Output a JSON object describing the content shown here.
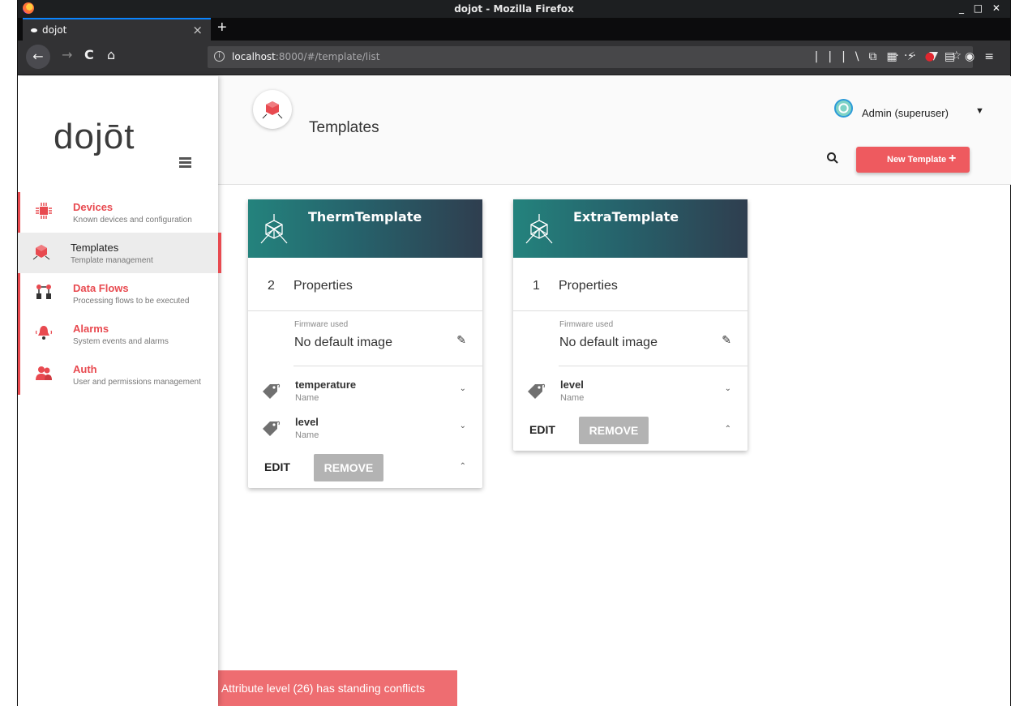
{
  "window": {
    "title": "dojot - Mozilla Firefox",
    "controls": "_ □ ✕"
  },
  "tab": {
    "label": "dojot",
    "close": "×",
    "new_tab": "+"
  },
  "navbar": {
    "back": "←",
    "forward": "→",
    "reload": "C",
    "home": "⌂",
    "url_host": "localhost",
    "url_path": ":8000/#/template/list",
    "info_icon": "i",
    "page_actions": "··· ▼ ☆"
  },
  "toolbar_icons": [
    "|||\\",
    "⧉",
    "▦",
    "⚡",
    "●",
    "▤",
    "◉",
    "≡"
  ],
  "sidebar": {
    "logo": "dojōt",
    "items": [
      {
        "label": "Devices",
        "sub": "Known devices and configuration",
        "icon": "chip-icon"
      },
      {
        "label": "Templates",
        "sub": "Template management",
        "icon": "cube-icon",
        "active": true
      },
      {
        "label": "Data Flows",
        "sub": "Processing flows to be executed",
        "icon": "flow-icon"
      },
      {
        "label": "Alarms",
        "sub": "System events and alarms",
        "icon": "bell-icon"
      },
      {
        "label": "Auth",
        "sub": "User and permissions management",
        "icon": "users-icon"
      }
    ]
  },
  "header": {
    "title": "Templates",
    "user": "Admin (superuser)",
    "caret": "▼",
    "search": "🔍",
    "new_button": "New Template",
    "new_plus": "+"
  },
  "cards": [
    {
      "name": "ThermTemplate",
      "count": "2",
      "props_label": "Properties",
      "fw_label": "Firmware used",
      "fw_value": "No default image",
      "attrs": [
        {
          "name": "temperature",
          "sub": "Name"
        },
        {
          "name": "level",
          "sub": "Name"
        }
      ],
      "edit": "EDIT",
      "remove": "REMOVE"
    },
    {
      "name": "ExtraTemplate",
      "count": "1",
      "props_label": "Properties",
      "fw_label": "Firmware used",
      "fw_value": "No default image",
      "attrs": [
        {
          "name": "level",
          "sub": "Name"
        }
      ],
      "edit": "EDIT",
      "remove": "REMOVE"
    }
  ],
  "chevron_down": "⌄",
  "chevron_up": "⌃",
  "pencil": "✎",
  "toast": "Attribute level (26) has standing conflicts",
  "colors": {
    "accent": "#e84a50",
    "header_teal": "#24837d",
    "header_dark": "#2f3e4f"
  }
}
